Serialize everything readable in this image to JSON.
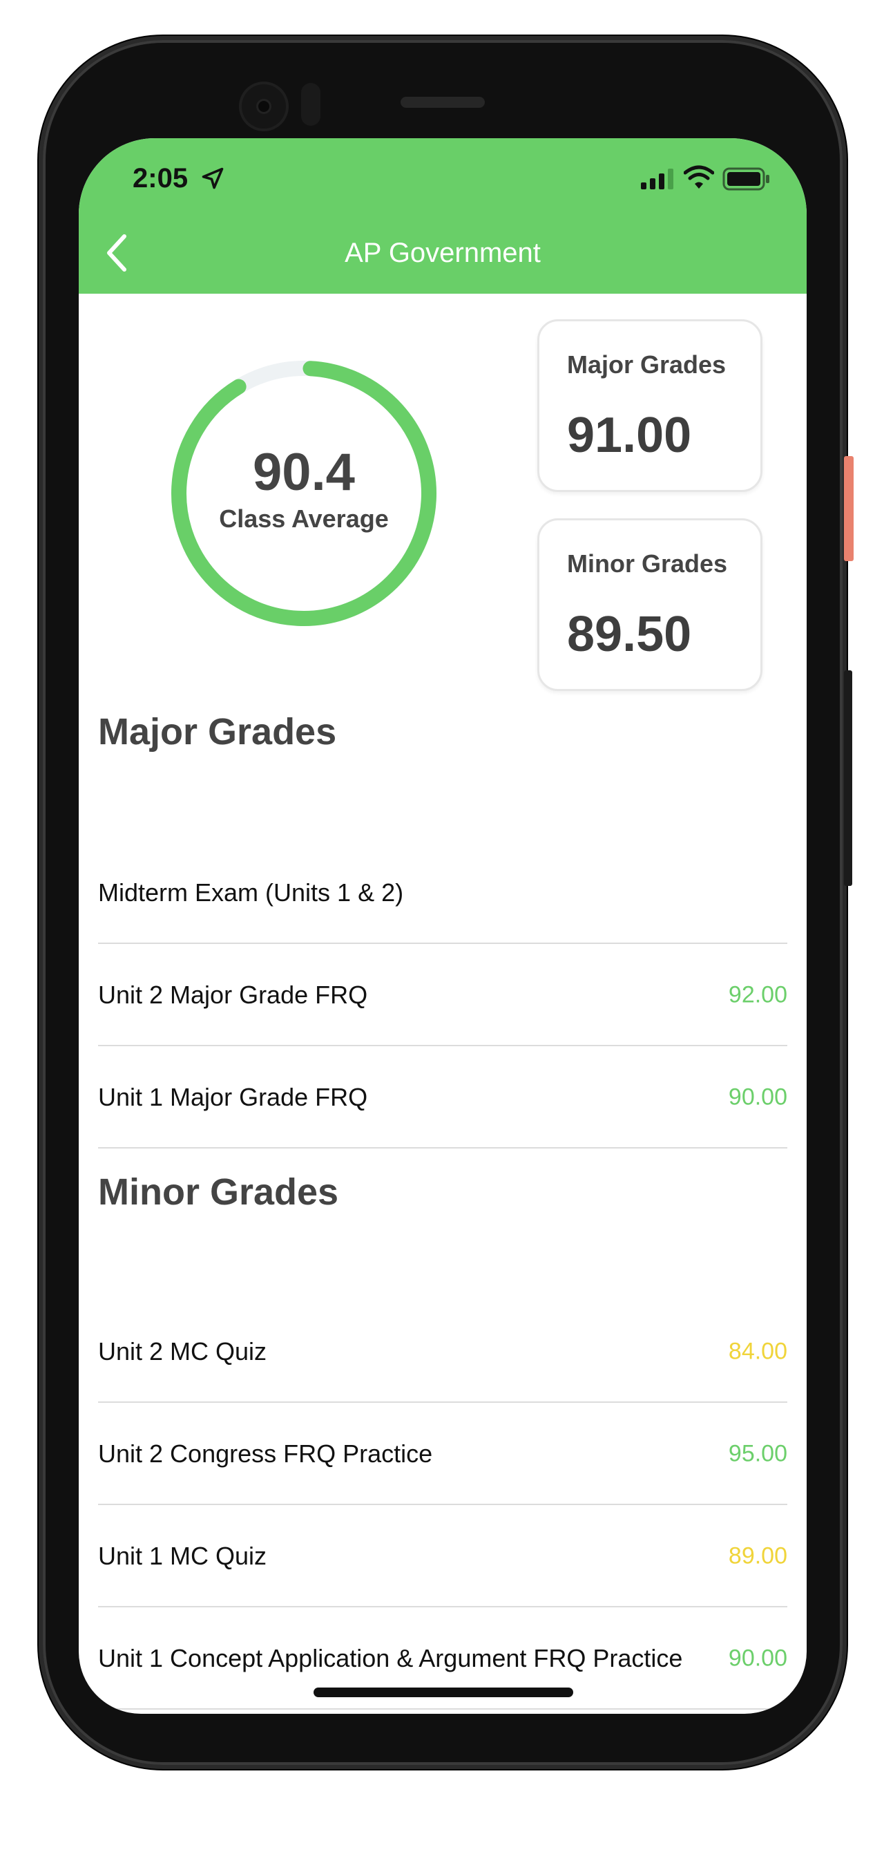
{
  "status_bar": {
    "time": "2:05"
  },
  "header": {
    "title": "AP Government"
  },
  "summary": {
    "class_average": "90.4",
    "class_average_label": "Class Average",
    "class_average_percent": 90.4,
    "major_label": "Major Grades",
    "major_value": "91.00",
    "minor_label": "Minor Grades",
    "minor_value": "89.50"
  },
  "major_grades": {
    "title": "Major Grades",
    "items": [
      {
        "name": "Midterm Exam (Units 1 & 2)",
        "score": "",
        "color": "#6ccf6b"
      },
      {
        "name": "Unit 2 Major Grade FRQ",
        "score": "92.00",
        "color": "#6ccf6b"
      },
      {
        "name": "Unit 1 Major Grade FRQ",
        "score": "90.00",
        "color": "#6ccf6b"
      }
    ]
  },
  "minor_grades": {
    "title": "Minor Grades",
    "items": [
      {
        "name": "Unit 2 MC Quiz",
        "score": "84.00",
        "color": "#f0d43a"
      },
      {
        "name": "Unit 2 Congress FRQ Practice",
        "score": "95.00",
        "color": "#6ccf6b"
      },
      {
        "name": "Unit 1 MC Quiz",
        "score": "89.00",
        "color": "#f0d43a"
      },
      {
        "name": "Unit 1 Concept Application & Argument FRQ Practice",
        "score": "90.00",
        "color": "#6ccf6b"
      }
    ]
  },
  "colors": {
    "accent": "#69cf68",
    "ring_track": "#eef2f4",
    "text_dark": "#444444"
  }
}
